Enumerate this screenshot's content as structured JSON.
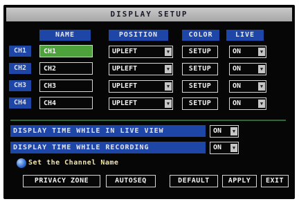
{
  "title": "DISPLAY SETUP",
  "headers": {
    "name": "NAME",
    "position": "POSITION",
    "color": "COLOR",
    "live": "LIVE"
  },
  "channels": [
    {
      "label": "CH1",
      "name": "CH1",
      "position": "UPLEFT",
      "color_btn": "SETUP",
      "live": "ON",
      "active": true
    },
    {
      "label": "CH2",
      "name": "CH2",
      "position": "UPLEFT",
      "color_btn": "SETUP",
      "live": "ON",
      "active": false
    },
    {
      "label": "CH3",
      "name": "CH3",
      "position": "UPLEFT",
      "color_btn": "SETUP",
      "live": "ON",
      "active": false
    },
    {
      "label": "CH4",
      "name": "CH4",
      "position": "UPLEFT",
      "color_btn": "SETUP",
      "live": "ON",
      "active": false
    }
  ],
  "options": {
    "live_view_label": "DISPLAY TIME WHILE IN LIVE VIEW",
    "live_view_value": "ON",
    "recording_label": "DISPLAY TIME WHILE RECORDING",
    "recording_value": "ON"
  },
  "hint": "Set the Channel Name",
  "buttons": {
    "privacy_zone": "PRIVACY ZONE",
    "autoseq": "AUTOSEQ",
    "default": "DEFAULT",
    "apply": "APPLY",
    "exit": "EXIT"
  },
  "colors": {
    "background": "#060606",
    "header_blue": "#1e46a6",
    "active_green": "#4ea23c",
    "title_bar": "#b8b8b8"
  },
  "icons": {
    "hint": "info-bubble-icon",
    "dropdown": "dropdown-arrow-icon"
  }
}
